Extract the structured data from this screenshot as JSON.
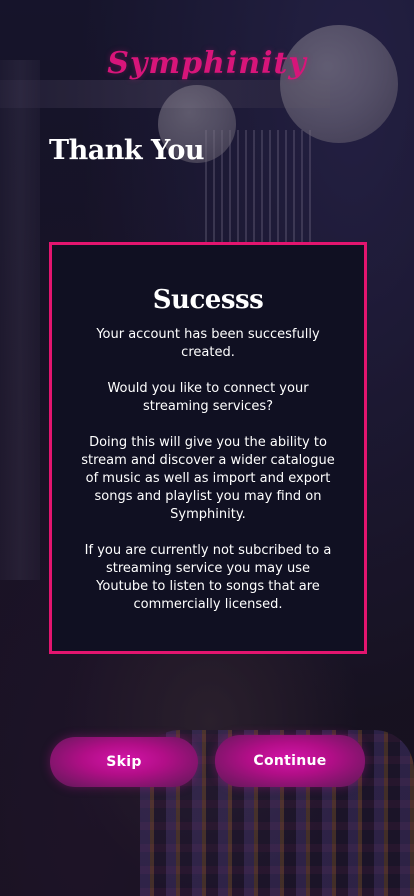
{
  "app": {
    "logo_text": "Symphinity",
    "accent_color": "#e3156f"
  },
  "header": {
    "title": "Thank You"
  },
  "card": {
    "title": "Sucesss",
    "paragraph_1": "Your account has been succesfully created.",
    "paragraph_2": "Would you like to connect your streaming services?",
    "paragraph_3": "Doing this will give you the ability to stream and discover a wider catalogue of music as well as import and export songs and playlist you may find on Symphinity.",
    "paragraph_4": "If you are currently not subcribed to a streaming service you may use Youtube to listen to songs that are commercially licensed."
  },
  "actions": {
    "skip_label": "Skip",
    "continue_label": "Continue"
  }
}
